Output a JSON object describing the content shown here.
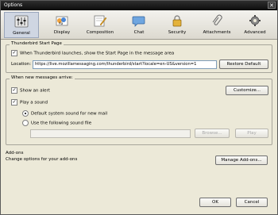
{
  "window": {
    "title": "Options"
  },
  "tabs": [
    {
      "label": "General",
      "icon": "gear-sliders-icon"
    },
    {
      "label": "Display",
      "icon": "display-palette-icon"
    },
    {
      "label": "Composition",
      "icon": "composition-pencil-icon"
    },
    {
      "label": "Chat",
      "icon": "chat-bubble-icon"
    },
    {
      "label": "Security",
      "icon": "security-lock-icon"
    },
    {
      "label": "Attachments",
      "icon": "paperclip-icon"
    },
    {
      "label": "Advanced",
      "icon": "gear-icon"
    }
  ],
  "start_page": {
    "title": "Thunderbird Start Page",
    "show_label": "When Thunderbird launches, show the Start Page in the message area",
    "show_checked": true,
    "location_label": "Location:",
    "location_value": "https://live.mozillamessaging.com/thunderbird/start?locale=en-US&version=1",
    "restore_label": "Restore Default"
  },
  "new_messages": {
    "title": "When new messages arrive:",
    "show_alert_label": "Show an alert",
    "show_alert_checked": true,
    "customize_label": "Customize...",
    "play_sound_label": "Play a sound",
    "play_sound_checked": true,
    "default_sound_label": "Default system sound for new mail",
    "use_file_label": "Use the following sound file",
    "file_value": "",
    "browse_label": "Browse...",
    "play_label": "Play"
  },
  "addons": {
    "title": "Add-ons",
    "description": "Change options for your add-ons",
    "manage_label": "Manage Add-ons..."
  },
  "footer": {
    "ok_label": "OK",
    "cancel_label": "Cancel"
  }
}
